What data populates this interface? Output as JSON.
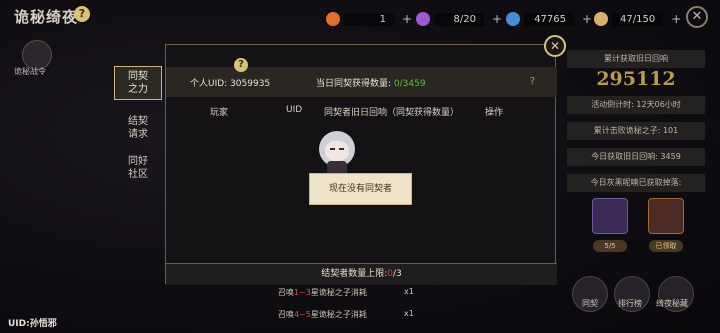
{
  "game_title": "诡秘绮夜",
  "resources": [
    {
      "value": "1",
      "icon": "fire-icon",
      "color": "#e07030"
    },
    {
      "value": "8/20",
      "icon": "potion-icon",
      "color": "#a05ad0"
    },
    {
      "value": "47765",
      "icon": "crystal-icon",
      "color": "#4a8ad8"
    },
    {
      "value": "47/150",
      "icon": "feather-icon",
      "color": "#d8b070"
    }
  ],
  "left": {
    "emblem_label": "诡秘战令",
    "user_uid": "UID:孙悟邪"
  },
  "tabs": [
    {
      "label_line1": "同契",
      "label_line2": "之力"
    },
    {
      "label_line1": "结契",
      "label_line2": "请求"
    },
    {
      "label_line1": "同好",
      "label_line2": "社区"
    }
  ],
  "dialog": {
    "uid_label": "个人UID: 3059935",
    "today_label": "当日同契获得数量:",
    "today_value": "0/3459",
    "help_mark": "?",
    "columns": [
      "玩家",
      "UID",
      "同契者旧日回响（同契获得数量）",
      "操作"
    ],
    "empty_text": "现在没有同契者",
    "footer_label": "结契者数量上限:",
    "footer_current": "0",
    "footer_max": "/3"
  },
  "right_panel": {
    "total_label": "累计获取旧日回响",
    "total_value": "295112",
    "countdown": "活动倒计时: 12天06小时",
    "kills": "累计击败诡秘之子: 101",
    "today_echo": "今日获取旧日回响: 3459",
    "today_drop": "今日灰黑呢喃已获取掉落:",
    "item_tags": [
      "5/5",
      "已领取"
    ],
    "buttons": [
      "同契",
      "排行榜",
      "绮夜秘藏"
    ]
  },
  "quests": [
    {
      "prefix": "召唤",
      "stars": "1~3",
      "suffix": "星诡秘之子消耗",
      "count": "x1"
    },
    {
      "prefix": "召唤",
      "stars": "4~5",
      "suffix": "星诡秘之子消耗",
      "count": "x1"
    }
  ]
}
